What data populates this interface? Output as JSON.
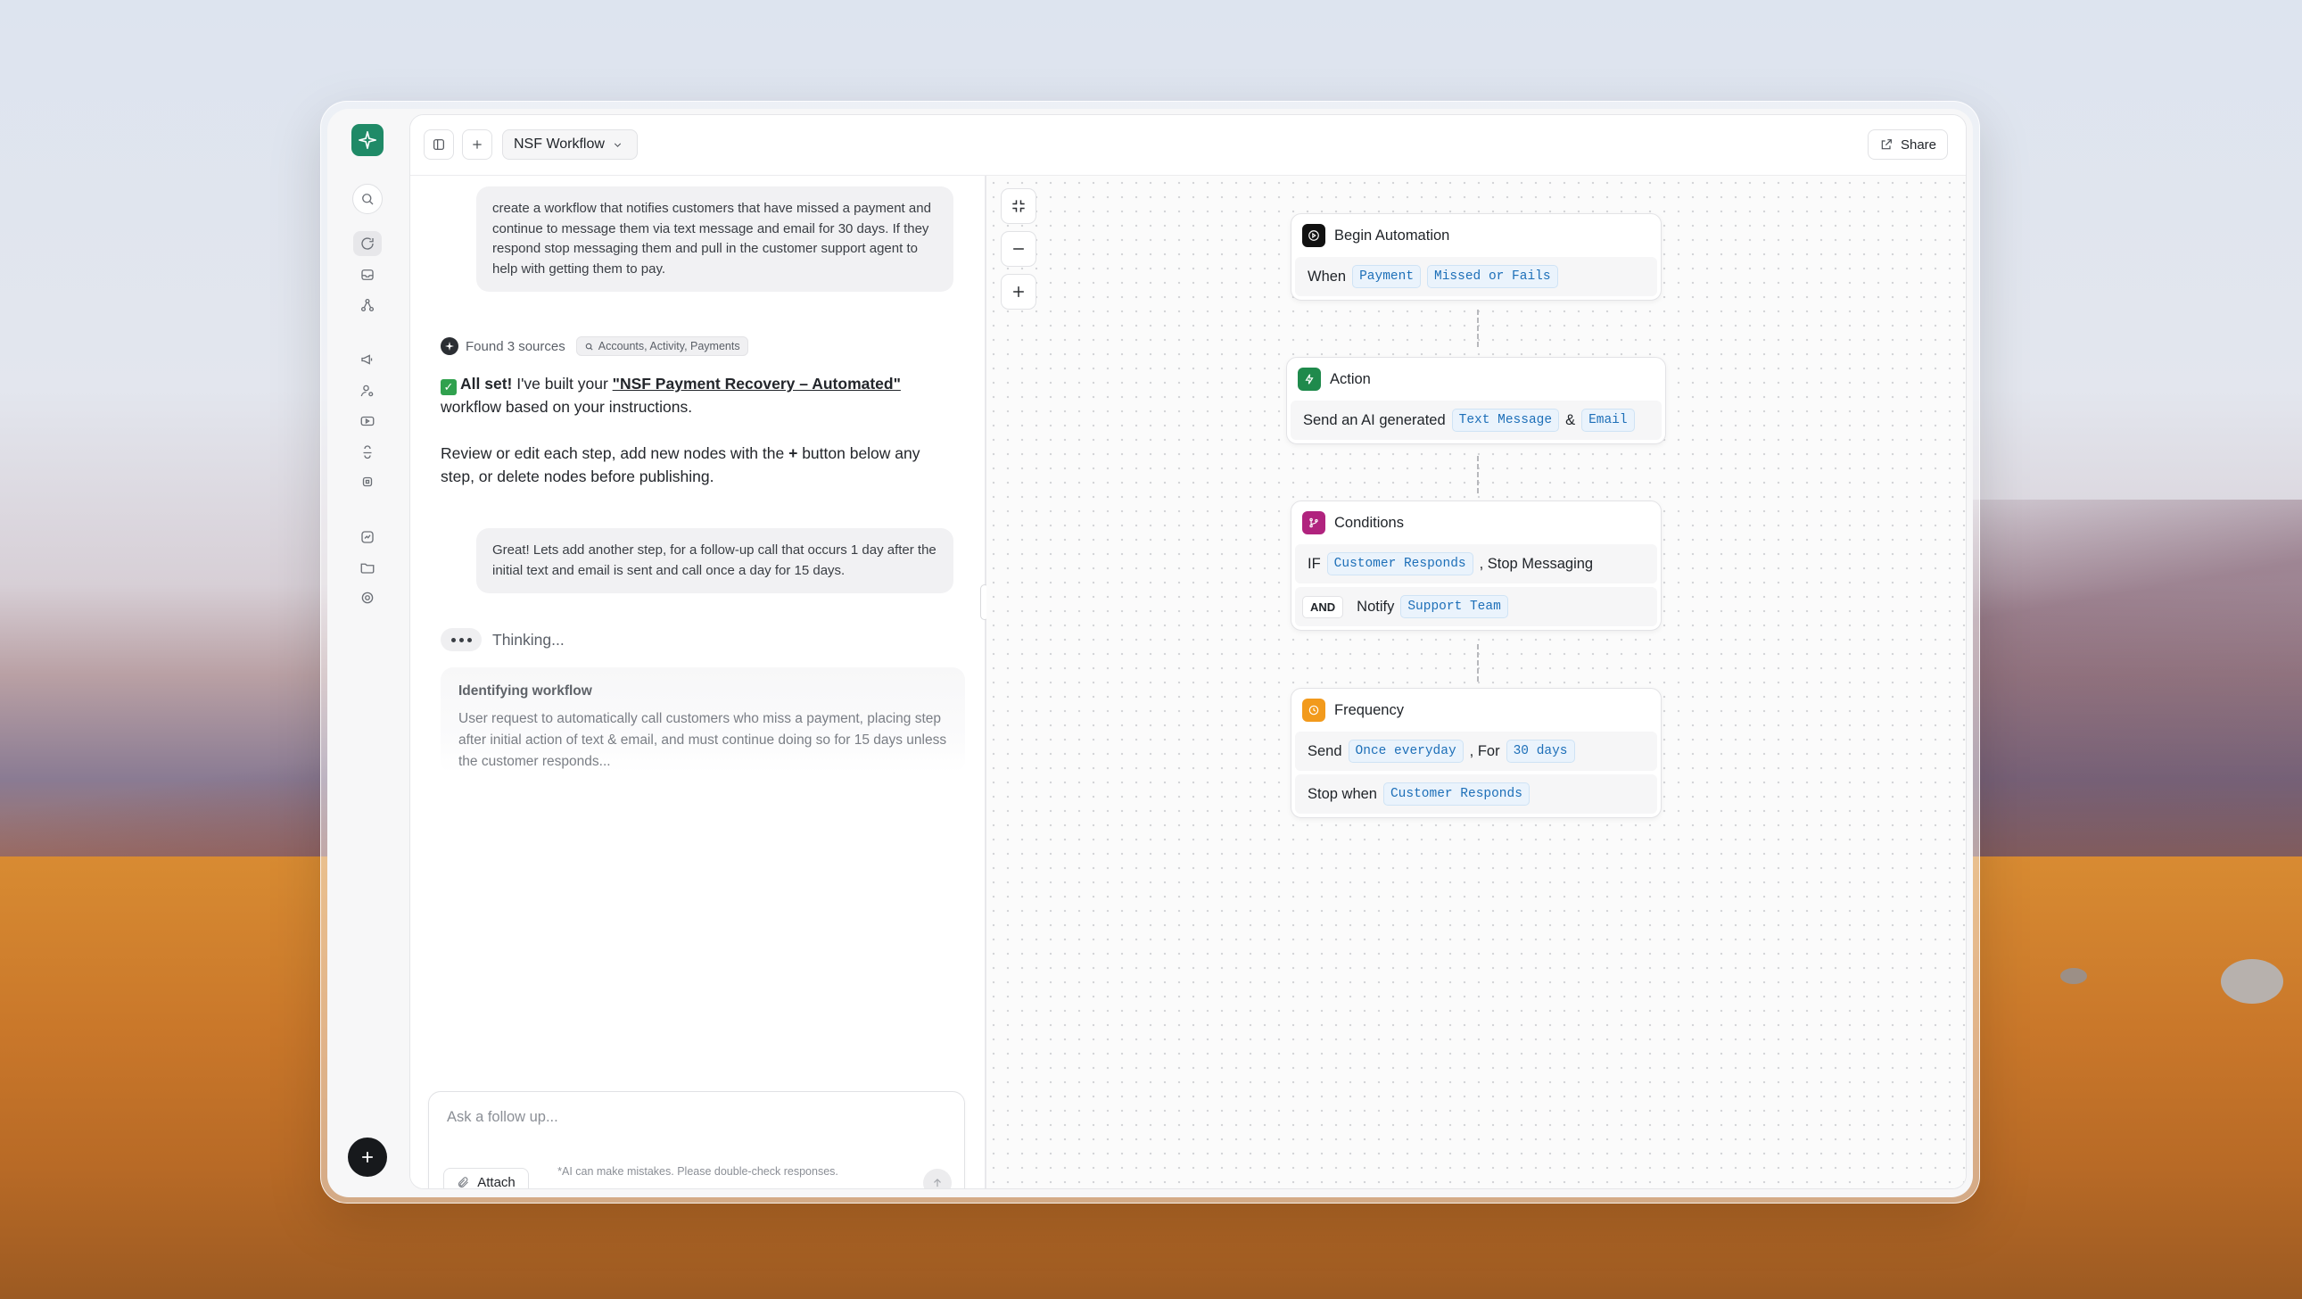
{
  "topbar": {
    "workflow_name": "NSF Workflow",
    "share_label": "Share"
  },
  "chat": {
    "user_message_1": "create a workflow that notifies customers that have missed a payment and continue to message them via text message and email for 30 days. If they respond stop messaging them and pull in the customer support agent to help with getting them to pay.",
    "sources_label": "Found 3 sources",
    "sources_chip": "Accounts, Activity, Payments",
    "reply_lead": "All set!",
    "reply_mid": " I've built your ",
    "reply_link": "\"NSF Payment Recovery – Automated\"",
    "reply_tail": " workflow based on your instructions.",
    "reply_p2_a": "Review or edit each step, add new nodes with the ",
    "reply_p2_plus": "+",
    "reply_p2_b": " button below any step, or delete nodes before publishing.",
    "user_message_2": "Great! Lets add another step, for a follow-up call that occurs 1 day after the initial text and email is sent and call once a day for 15 days.",
    "thinking_label": "Thinking...",
    "think_title": "Identifying workflow",
    "think_text": "User request to automatically call customers who miss a payment, placing step after initial action of text & email, and must continue doing so for 15 days unless the customer responds...",
    "composer_placeholder": "Ask a follow up...",
    "attach_label": "Attach",
    "disclaimer": "*AI can make mistakes. Please double-check responses."
  },
  "nodes": {
    "begin": {
      "title": "Begin Automation",
      "when": "When",
      "tag1": "Payment",
      "tag2": "Missed or Fails",
      "color": "#111111"
    },
    "action": {
      "title": "Action",
      "text": "Send an AI generated",
      "tag1": "Text Message",
      "amp": "&",
      "tag2": "Email",
      "color": "#1f8a4c"
    },
    "conditions": {
      "title": "Conditions",
      "if": "IF",
      "tag1": "Customer Responds",
      "comma_text": ", Stop Messaging",
      "and": "AND",
      "notify": "Notify",
      "tag2": "Support Team",
      "color": "#b0237e"
    },
    "frequency": {
      "title": "Frequency",
      "send": "Send",
      "tag1": "Once everyday",
      "for_text": ", For",
      "tag2": "30 days",
      "stop": "Stop when",
      "tag3": "Customer Responds",
      "color": "#f29a1c"
    }
  }
}
